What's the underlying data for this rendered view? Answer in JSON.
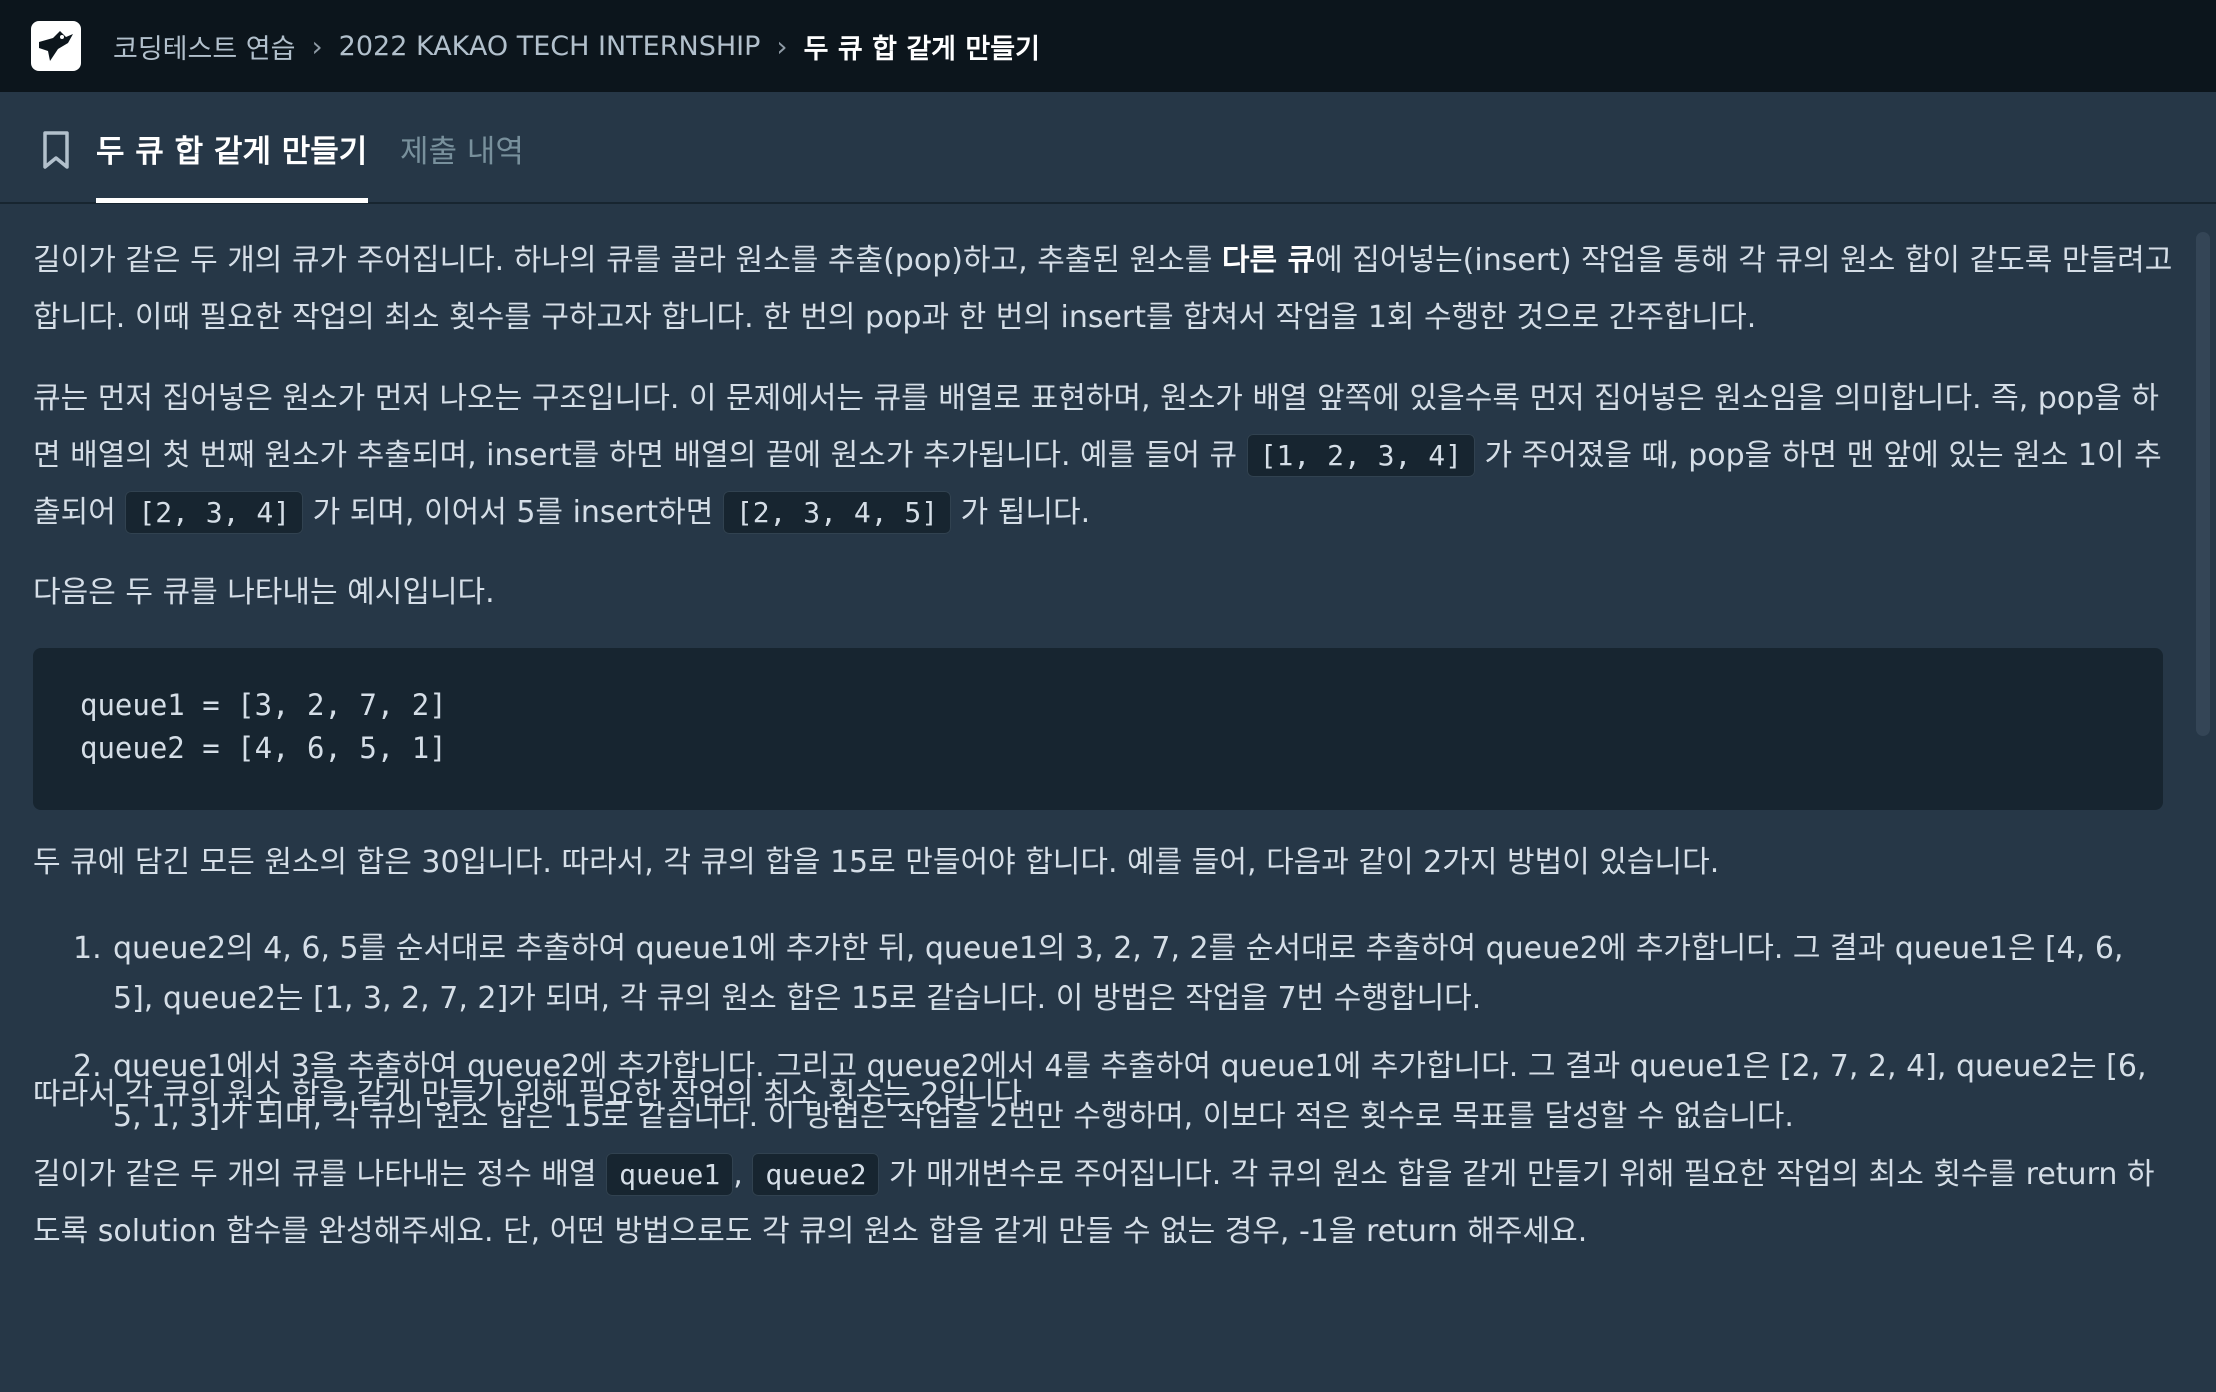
{
  "topbar": {
    "breadcrumbs": [
      "코딩테스트 연습",
      "2022 KAKAO TECH INTERNSHIP",
      "두 큐 합 같게 만들기"
    ],
    "separator": "›"
  },
  "tabs": [
    {
      "label": "두 큐 합 같게 만들기",
      "active": true
    },
    {
      "label": "제출 내역",
      "active": false
    }
  ],
  "content": {
    "p1_a": "길이가 같은 두 개의 큐가 주어집니다. 하나의 큐를 골라 원소를 추출(pop)하고, 추출된 원소를 ",
    "p1_bold": "다른 큐",
    "p1_b": "에 집어넣는(insert) 작업을 통해 각 큐의 원소 합이 같도록 만들려고 합니다. 이때 필요한 작업의 최소 횟수를 구하고자 합니다. 한 번의 pop과 한 번의 insert를 합쳐서 작업을 1회 수행한 것으로 간주합니다.",
    "p2_a": "큐는 먼저 집어넣은 원소가 먼저 나오는 구조입니다. 이 문제에서는 큐를 배열로 표현하며, 원소가 배열 앞쪽에 있을수록 먼저 집어넣은 원소임을 의미합니다. 즉, pop을 하면 배열의 첫 번째 원소가 추출되며, insert를 하면 배열의 끝에 원소가 추가됩니다. 예를 들어 큐 ",
    "p2_code1": "[1, 2, 3, 4]",
    "p2_b": " 가 주어졌을 때, pop을 하면 맨 앞에 있는 원소 1이 추출되어 ",
    "p2_code2": "[2, 3, 4]",
    "p2_c": " 가 되며, 이어서 5를 insert하면 ",
    "p2_code3": "[2, 3, 4, 5]",
    "p2_d": " 가 됩니다.",
    "p3": "다음은 두 큐를 나타내는 예시입니다.",
    "code_line1": "queue1 = [3, 2, 7, 2]",
    "code_line2": "queue2 = [4, 6, 5, 1]",
    "p4": "두 큐에 담긴 모든 원소의 합은 30입니다. 따라서, 각 큐의 합을 15로 만들어야 합니다. 예를 들어, 다음과 같이 2가지 방법이 있습니다.",
    "list": [
      {
        "num": "1.",
        "text": "queue2의 4, 6, 5를 순서대로 추출하여 queue1에 추가한 뒤, queue1의 3, 2, 7, 2를 순서대로 추출하여 queue2에 추가합니다. 그 결과 queue1은 [4, 6, 5], queue2는 [1, 3, 2, 7, 2]가 되며, 각 큐의 원소 합은 15로 같습니다. 이 방법은 작업을 7번 수행합니다."
      },
      {
        "num": "2.",
        "text": "queue1에서 3을 추출하여 queue2에 추가합니다. 그리고 queue2에서 4를 추출하여 queue1에 추가합니다. 그 결과 queue1은 [2, 7, 2, 4], queue2는 [6, 5, 1, 3]가 되며, 각 큐의 원소 합은 15로 같습니다. 이 방법은 작업을 2번만 수행하며, 이보다 적은 횟수로 목표를 달성할 수 없습니다."
      }
    ],
    "p5": "따라서 각 큐의 원소 합을 같게 만들기 위해 필요한 작업의 최소 횟수는 2입니다.",
    "p6_a": "길이가 같은 두 개의 큐를 나타내는 정수 배열 ",
    "p6_code1": "queue1",
    "p6_comma": ", ",
    "p6_code2": "queue2",
    "p6_b": " 가 매개변수로 주어집니다. 각 큐의 원소 합을 같게 만들기 위해 필요한 작업의 최소 횟수를 return 하도록 solution 함수를 완성해주세요. 단, 어떤 방법으로도 각 큐의 원소 합을 같게 만들 수 없는 경우, -1을 return 해주세요."
  }
}
